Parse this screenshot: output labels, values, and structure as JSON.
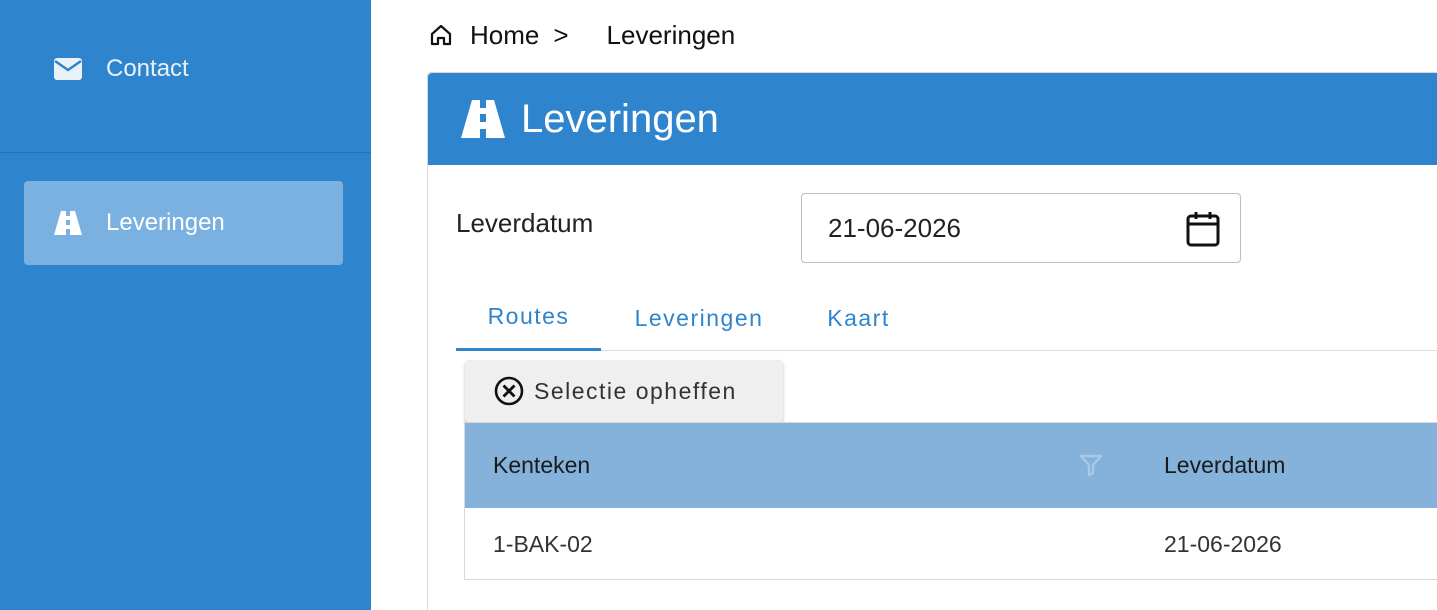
{
  "sidebar": {
    "items": [
      {
        "label": "Contact",
        "icon": "envelope-icon"
      },
      {
        "label": "Leveringen",
        "icon": "road-icon",
        "active": true
      }
    ]
  },
  "breadcrumb": {
    "home_icon": "home-icon",
    "home_label": "Home",
    "separator": ">",
    "current": "Leveringen"
  },
  "panel": {
    "title": "Leveringen",
    "title_icon": "road-icon"
  },
  "form": {
    "date_label": "Leverdatum",
    "date_value": "21-06-2026",
    "date_icon": "calendar-icon"
  },
  "tabs": [
    {
      "label": "Routes",
      "active": true
    },
    {
      "label": "Leveringen",
      "active": false
    },
    {
      "label": "Kaart",
      "active": false
    }
  ],
  "actions": {
    "clear_selection_label": "Selectie opheffen",
    "clear_icon": "close-circle-icon"
  },
  "table": {
    "columns": [
      "Kenteken",
      "Leverdatum"
    ],
    "filter_icon": "filter-icon",
    "rows": [
      [
        "1-BAK-02",
        "21-06-2026"
      ]
    ]
  },
  "colors": {
    "primary": "#2e85cd",
    "sidebar_active": "#7ab1e0",
    "table_header": "#84b2da"
  }
}
